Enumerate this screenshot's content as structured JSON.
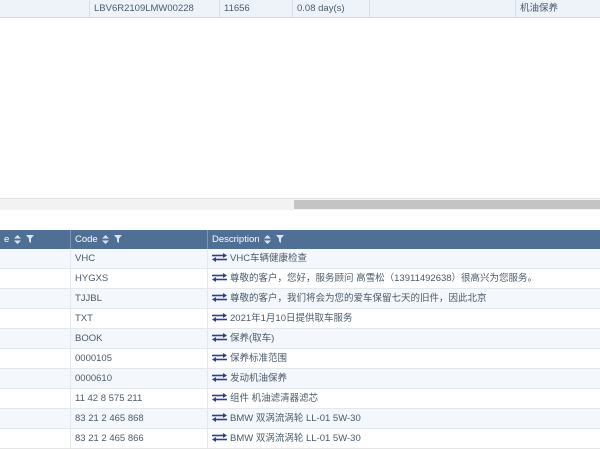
{
  "top_grid": {
    "row": {
      "vin": "LBV6R2109LMW00228",
      "mileage": "11656",
      "duration": "0.08 day(s)",
      "service": "机油保养"
    }
  },
  "job_grid": {
    "headers": {
      "col0": "e",
      "code": "Code",
      "description": "Description"
    },
    "rows": [
      {
        "code": "VHC",
        "description": "VHC车辆健康检查"
      },
      {
        "code": "HYGXS",
        "description": "尊敬的客户，您好，服务顾问 高雪松（13911492638）很高兴为您服务。"
      },
      {
        "code": "TJJBL",
        "description": "尊敬的客户，我们将会为您的爱车保留七天的旧件，因此北京"
      },
      {
        "code": "TXT",
        "description": "2021年1月10日提供取车服务"
      },
      {
        "code": "BOOK",
        "description": "保养(取车)"
      },
      {
        "code": "0000105",
        "description": "保养标准范围"
      },
      {
        "code": "0000610",
        "description": "发动机油保养"
      },
      {
        "code": "11 42 8 575 211",
        "description": "组件 机油滤清器滤芯"
      },
      {
        "code": "83 21 2 465 868",
        "description": "BMW 双涡流涡轮 LL-01 5W-30"
      },
      {
        "code": "83 21 2 465 866",
        "description": "BMW 双涡流涡轮 LL-01 5W-30"
      }
    ]
  }
}
